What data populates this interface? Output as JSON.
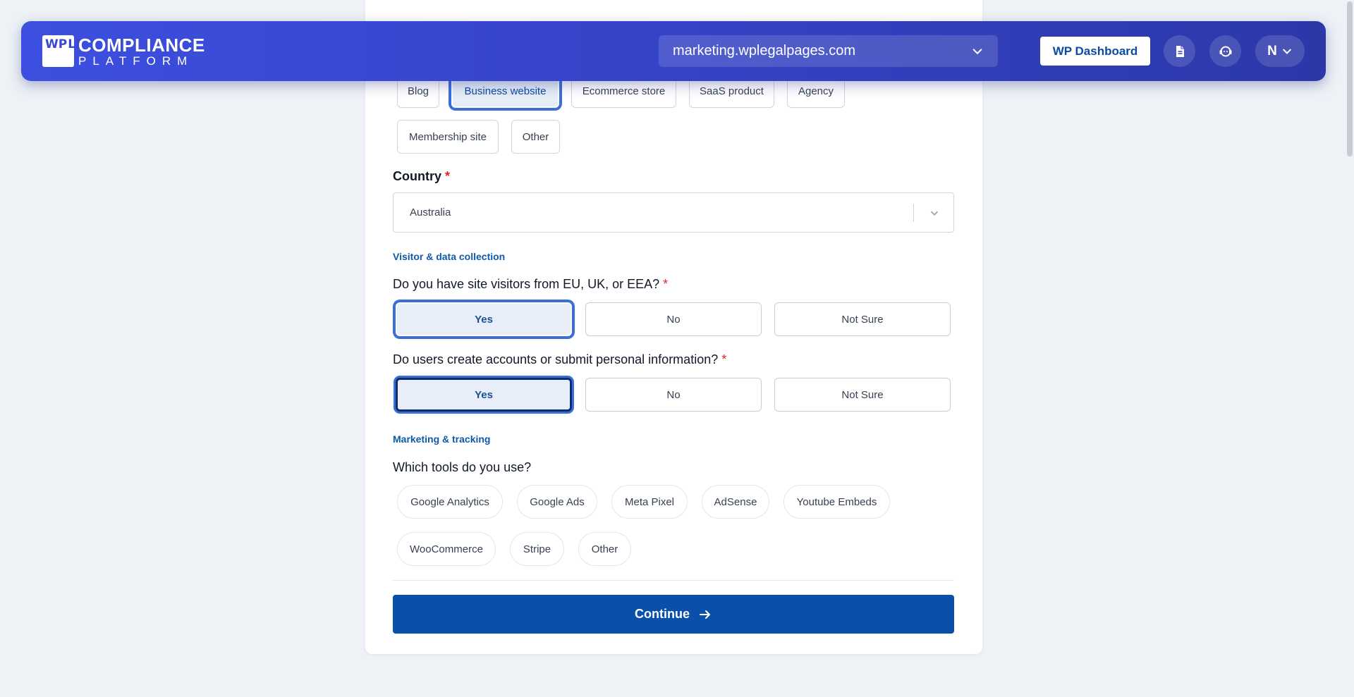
{
  "header": {
    "logo_mark": [
      "WP",
      "",
      "",
      "LP"
    ],
    "logo_line1": "COMPLIANCE",
    "logo_line2": "PLATFORM",
    "site": "marketing.wplegalpages.com",
    "wp_dashboard": "WP Dashboard",
    "user_initial": "N"
  },
  "site_types": [
    "Blog",
    "Business website",
    "Ecommerce store",
    "SaaS product",
    "Agency",
    "Membership site",
    "Other"
  ],
  "selected_site_type": "Business website",
  "country": {
    "label": "Country",
    "required": "*",
    "value": "Australia"
  },
  "visitor_section": "Visitor & data collection",
  "q_eu": {
    "label": "Do you have site visitors from EU, UK, or EEA?",
    "required": "*",
    "options": [
      "Yes",
      "No",
      "Not Sure"
    ],
    "selected": "Yes"
  },
  "q_accounts": {
    "label": "Do users create accounts or submit personal information?",
    "required": "*",
    "options": [
      "Yes",
      "No",
      "Not Sure"
    ],
    "selected": "Yes"
  },
  "marketing_section": "Marketing & tracking",
  "tools": {
    "label": "Which tools do you use?",
    "options": [
      "Google Analytics",
      "Google Ads",
      "Meta Pixel",
      "AdSense",
      "Youtube Embeds",
      "WooCommerce",
      "Stripe",
      "Other"
    ]
  },
  "continue_label": "Continue",
  "colors": {
    "header_start": "#3d4fe0",
    "header_end": "#2c38a8",
    "primary": "#0a4faa",
    "selected_ring": "#3b6fd8",
    "required": "#dc2626"
  }
}
